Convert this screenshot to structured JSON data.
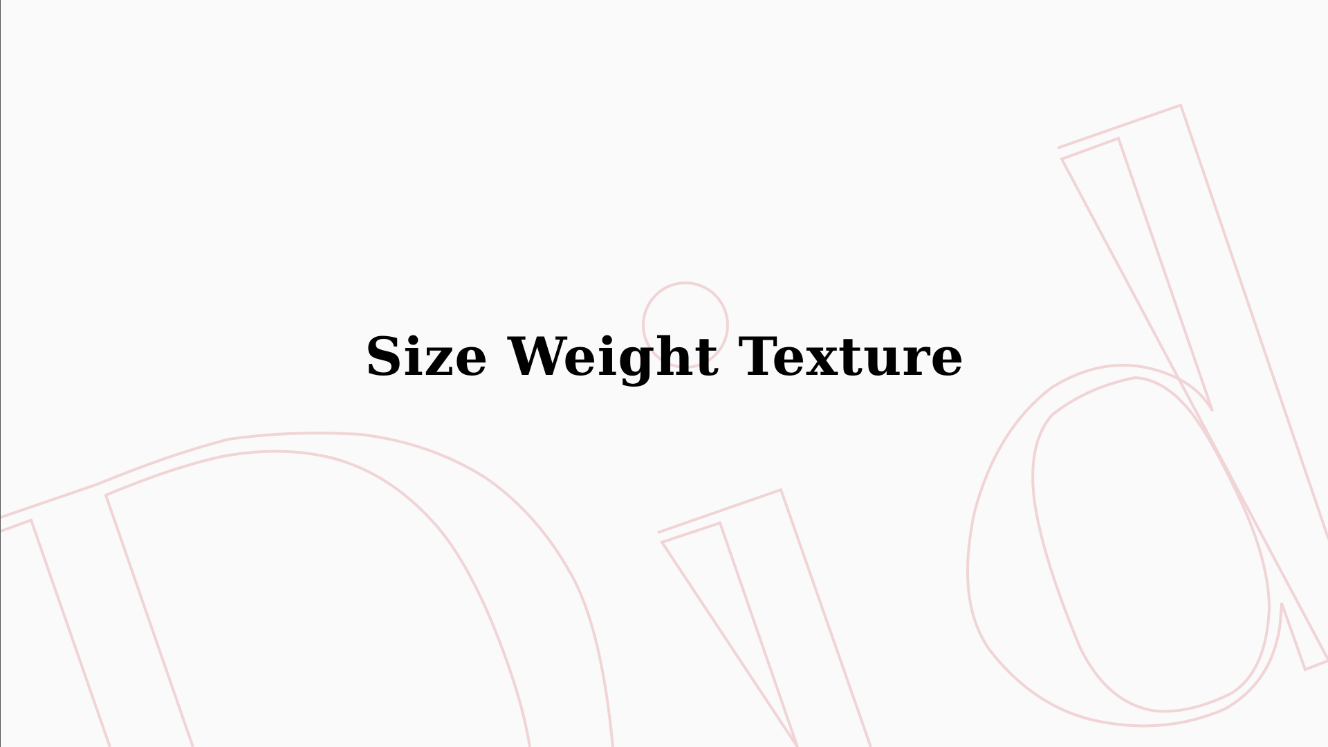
{
  "slide": {
    "title": "Size Weight Texture",
    "background_color": "#fafafa",
    "title_color": "#000000",
    "outline_color": "#f0d4d6"
  },
  "decorations": {
    "outline_letters": [
      "h",
      "i",
      "d"
    ]
  }
}
